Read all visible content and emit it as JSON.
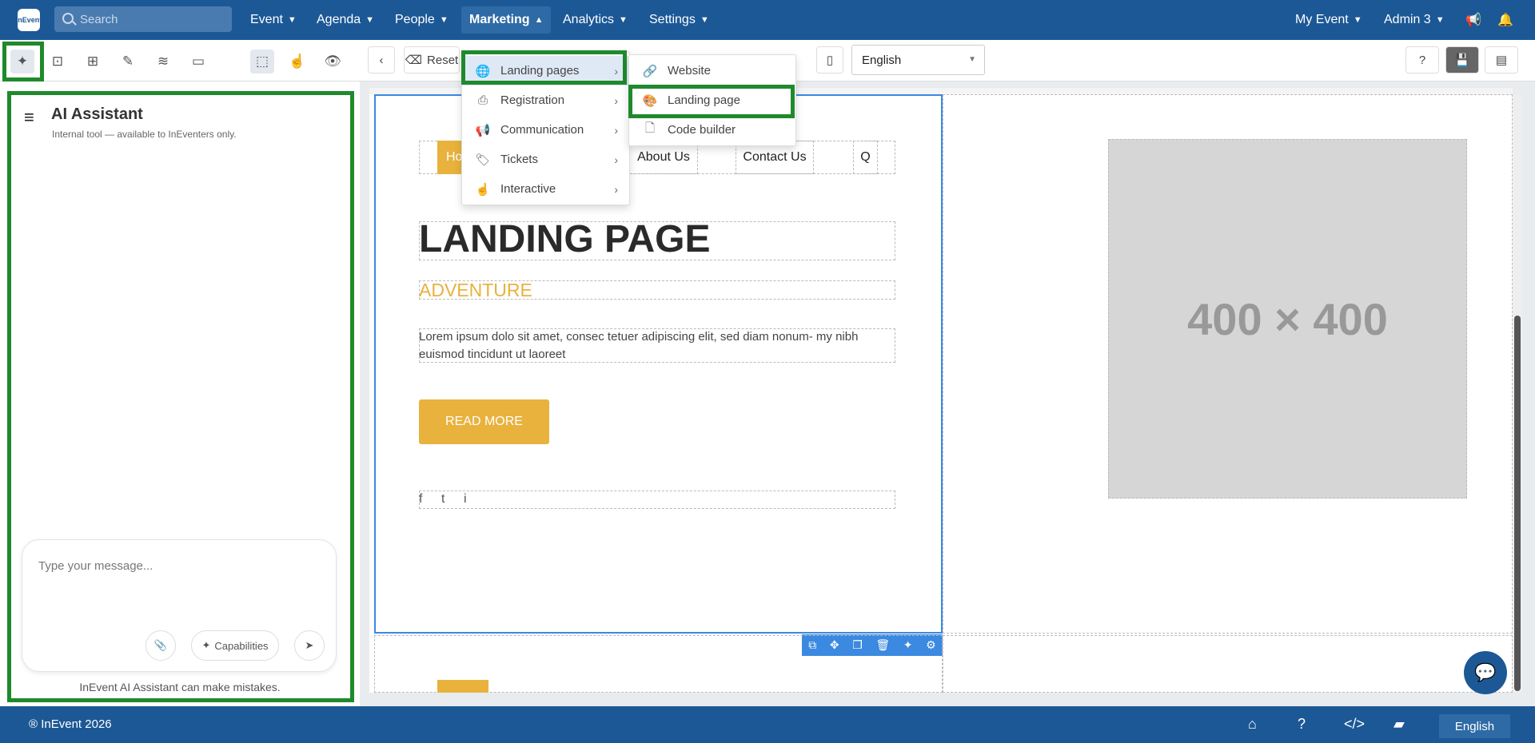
{
  "topbar": {
    "logo_text": "InEvent",
    "search_placeholder": "Search",
    "nav": [
      "Event",
      "Agenda",
      "People",
      "Marketing",
      "Analytics",
      "Settings"
    ],
    "active_nav": "Marketing",
    "my_event": "My Event",
    "admin": "Admin 3"
  },
  "ai_panel": {
    "title": "AI Assistant",
    "subtitle": "Internal tool — available to InEventers only.",
    "placeholder": "Type your message...",
    "capabilities": "Capabilities",
    "footer": "InEvent AI Assistant can make mistakes."
  },
  "editor": {
    "reset_label": "Reset",
    "language": "English"
  },
  "marketing_menu": [
    {
      "label": "Landing pages",
      "icon": "globe-icon"
    },
    {
      "label": "Registration",
      "icon": "printer-icon"
    },
    {
      "label": "Communication",
      "icon": "megaphone-icon"
    },
    {
      "label": "Tickets",
      "icon": "tags-icon"
    },
    {
      "label": "Interactive",
      "icon": "pointer-icon"
    }
  ],
  "landing_submenu": [
    {
      "label": "Website",
      "icon": "link-icon"
    },
    {
      "label": "Landing page",
      "icon": "palette-icon"
    },
    {
      "label": "Code builder",
      "icon": "file-icon"
    }
  ],
  "landing_page": {
    "nav": {
      "home": "Ho",
      "about": "About Us",
      "contact": "Contact Us",
      "search": "Q"
    },
    "headline": "LANDING PAGE",
    "subheadline": "ADVENTURE",
    "body": "Lorem ipsum dolo sit amet, consec tetuer adipiscing elit, sed diam nonum- my nibh euismod tincidunt ut laoreet",
    "cta": "READ MORE",
    "social": [
      "f",
      "t",
      "i"
    ],
    "image_placeholder": "400 × 400"
  },
  "footer": {
    "copyright": "® InEvent 2026",
    "language": "English"
  }
}
